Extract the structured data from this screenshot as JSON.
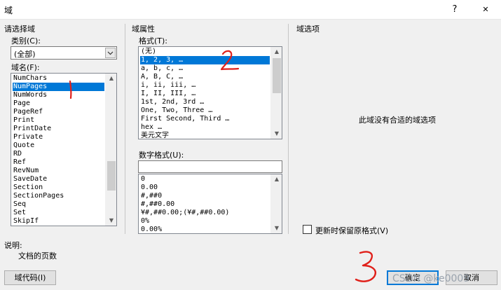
{
  "window": {
    "title": "域",
    "help_glyph": "?",
    "close_glyph": "✕"
  },
  "left": {
    "section_title": "请选择域",
    "category_label": "类别(C):",
    "category_value": "(全部)",
    "fieldname_label": "域名(F):",
    "fields": [
      "NumChars",
      "NumPages",
      "NumWords",
      "Page",
      "PageRef",
      "Print",
      "PrintDate",
      "Private",
      "Quote",
      "RD",
      "Ref",
      "RevNum",
      "SaveDate",
      "Section",
      "SectionPages",
      "Seq",
      "Set",
      "SkipIf"
    ],
    "selected_field_index": 1
  },
  "middle": {
    "section_title": "域属性",
    "format_label": "格式(T):",
    "formats": [
      "(无)",
      "1, 2, 3, …",
      "a, b, c, …",
      "A, B, C, …",
      "i, ii, iii, …",
      "I, II, III, …",
      "1st, 2nd, 3rd …",
      "One, Two, Three …",
      "First Second, Third …",
      "hex …",
      "美元文字"
    ],
    "selected_format_index": 1,
    "number_format_label": "数字格式(U):",
    "number_format_value": "",
    "number_formats": [
      "0",
      "0.00",
      "#,##0",
      "#,##0.00",
      "¥#,##0.00;(¥#,##0.00)",
      "0%",
      "0.00%"
    ]
  },
  "right": {
    "section_title": "域选项",
    "no_options_text": "此域没有合适的域选项",
    "preserve_format_label": "更新时保留原格式(V)",
    "preserve_format_checked": false
  },
  "description": {
    "label": "说明:",
    "text": "文档的页数"
  },
  "buttons": {
    "field_codes": "域代码(I)",
    "ok": "确定",
    "cancel": "取消"
  },
  "annotations": {
    "mark_1": "1",
    "mark_2": "2",
    "mark_3": "3"
  },
  "watermark": "CSDN @ke0009"
}
